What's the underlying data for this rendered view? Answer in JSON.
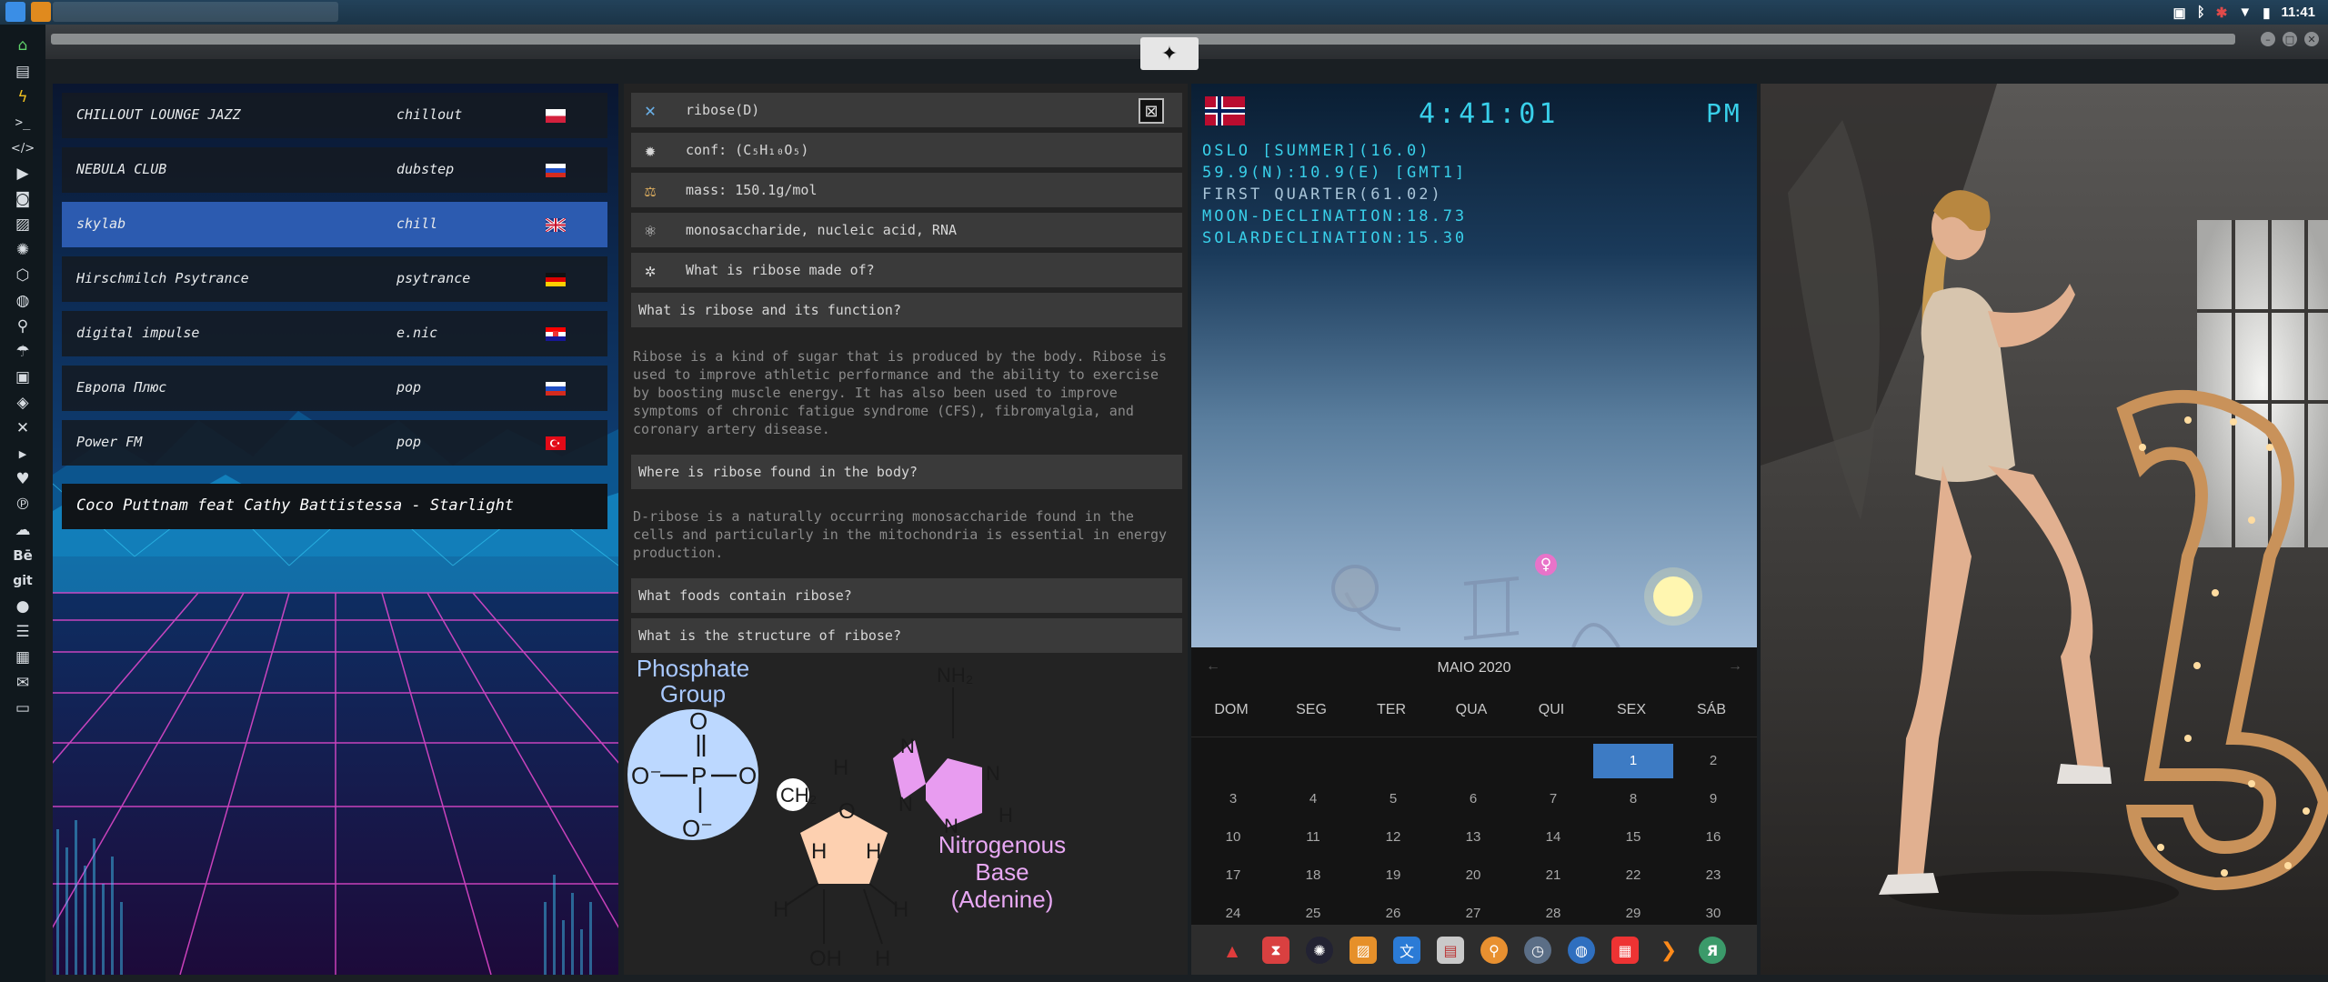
{
  "system_panel": {
    "time": "11:41",
    "icons": [
      "file-manager-icon",
      "sublime-icon",
      "window-icon",
      "screenshot-icon",
      "bluetooth-icon",
      "usb-icon",
      "wifi-icon",
      "battery-icon"
    ]
  },
  "launcher": {
    "icons": [
      "home-icon",
      "document-icon",
      "bolt-icon",
      "terminal-icon",
      "code-icon",
      "video-icon",
      "camera-icon",
      "image-icon",
      "aperture-icon",
      "hexagon-icon",
      "globe-icon",
      "search-icon",
      "umbrella-icon",
      "contact-icon",
      "tag-icon",
      "tools-icon",
      "youtube-icon",
      "heart-icon",
      "pinterest-icon",
      "cloud-icon",
      "behance-icon",
      "git-icon",
      "github-icon",
      "layers-icon",
      "map-icon",
      "mail-icon",
      "inbox-icon"
    ],
    "labels": {
      "behance": "Bē",
      "git": "git"
    }
  },
  "radio": {
    "stations": [
      {
        "name": "CHILLOUT LOUNGE JAZZ",
        "genre": "chillout",
        "flag": "pl"
      },
      {
        "name": "NEBULA CLUB",
        "genre": "dubstep",
        "flag": "ru"
      },
      {
        "name": "skylab",
        "genre": "chill",
        "flag": "uk",
        "selected": true
      },
      {
        "name": "Hirschmilch Psytrance",
        "genre": "psytrance",
        "flag": "de"
      },
      {
        "name": "digital impulse",
        "genre": "e.nic",
        "flag": "hr"
      },
      {
        "name": "Европа Плюс",
        "genre": "pop",
        "flag": "ru"
      },
      {
        "name": "Power FM",
        "genre": "pop",
        "flag": "tr"
      }
    ],
    "now_playing": "Coco Puttnam feat Cathy Battistessa - Starlight"
  },
  "molecule": {
    "rows": [
      {
        "icon": "molecule-icon",
        "label": "ribose(D)"
      },
      {
        "icon": "atom-icon",
        "label": "conf: (C₅H₁₀O₅)"
      },
      {
        "icon": "scale-icon",
        "label": "mass: 150.1g/mol"
      },
      {
        "icon": "atom-ring-icon",
        "label": "monosaccharide, nucleic acid, RNA"
      },
      {
        "icon": "sparkle-icon",
        "label": "What is ribose made of?"
      }
    ],
    "q1": "What is ribose and its function?",
    "a1": "Ribose is a kind of sugar that is produced by the body. Ribose is used to improve athletic performance and the ability to exercise by boosting muscle energy. It has also been used to improve symptoms of chronic fatigue syndrome (CFS), fibromyalgia, and coronary artery disease.",
    "q2": "Where is ribose found in the body?",
    "a2": "D-ribose is a naturally occurring monosaccharide found in the cells and particularly in the mitochondria is essential in energy production.",
    "q3": "What foods contain ribose?",
    "q4": "What is the structure of ribose?",
    "diagram": {
      "phosphate_title_1": "Phosphate",
      "phosphate_title_2": "Group",
      "base_title_1": "Nitrogenous",
      "base_title_2": "Base",
      "base_title_3": "(Adenine)",
      "atoms": {
        "O": "O",
        "P": "P",
        "H": "H",
        "N": "N",
        "NH2": "NH₂",
        "OH": "OH",
        "CH2": "CH₂",
        "Om": "O⁻"
      }
    }
  },
  "sky": {
    "time": "4:41:01",
    "ampm": "PM",
    "lines": [
      "OSLO [SUMMER](16.0)",
      "59.9(N):10.9(E) [GMT1]",
      "FIRST QUARTER(61.02)",
      "MOON-DECLINATION:18.73",
      "SOLARDECLINATION:15.30"
    ],
    "venus_symbol": "♀"
  },
  "calendar": {
    "month": "MAIO 2020",
    "prev": "←",
    "next": "→",
    "weekdays": [
      "DOM",
      "SEG",
      "TER",
      "QUA",
      "QUI",
      "SEX",
      "SÁB"
    ],
    "days": [
      "1",
      "2",
      "3",
      "4",
      "5",
      "6",
      "7",
      "8",
      "9",
      "10",
      "11",
      "12",
      "13",
      "14",
      "15",
      "16",
      "17",
      "18",
      "19",
      "20",
      "21",
      "22",
      "23",
      "24",
      "25",
      "26",
      "27",
      "28",
      "29",
      "30"
    ],
    "today": "1"
  },
  "dock": {
    "icons": [
      "arch-icon",
      "hourglass-icon",
      "dark-orb-icon",
      "image-viewer-icon",
      "translate-icon",
      "presentation-icon",
      "search-app-icon",
      "clock-icon",
      "browser-icon",
      "calendar-icon",
      "arrow-app-icon",
      "yandex-icon"
    ],
    "yandex_label": "Я"
  },
  "colors": {
    "accent": "#39d0ea",
    "selected_row": "#2c5bb0",
    "today": "#3d7bc4"
  }
}
